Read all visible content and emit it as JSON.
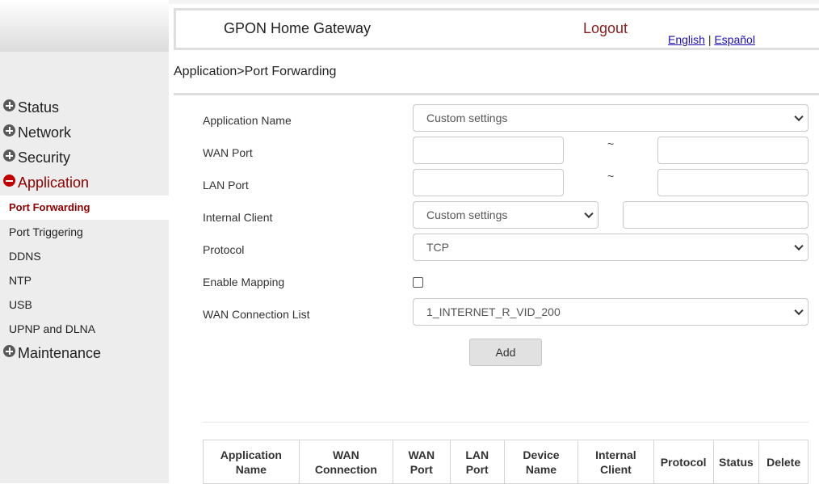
{
  "header": {
    "title": "GPON Home Gateway",
    "logout": "Logout",
    "lang_en": "English",
    "lang_sep": "|",
    "lang_es": "Español"
  },
  "breadcrumb": "Application>Port Forwarding",
  "menu": {
    "status": "Status",
    "network": "Network",
    "security": "Security",
    "application": "Application",
    "app_sub": [
      "Port Forwarding",
      "Port Triggering",
      "DDNS",
      "NTP",
      "USB",
      "UPNP and DLNA"
    ],
    "maintenance": "Maintenance"
  },
  "form": {
    "app_name_label": "Application Name",
    "app_name_value": "Custom settings",
    "wan_port_label": "WAN Port",
    "lan_port_label": "LAN Port",
    "range_sep": "~",
    "internal_client_label": "Internal Client",
    "internal_client_value": "Custom settings",
    "protocol_label": "Protocol",
    "protocol_value": "TCP",
    "enable_mapping_label": "Enable Mapping",
    "enable_mapping_checked": false,
    "wan_conn_label": "WAN Connection List",
    "wan_conn_value": "1_INTERNET_R_VID_200",
    "add_button": "Add"
  },
  "table": {
    "headers": [
      [
        "Application",
        "Name"
      ],
      [
        "WAN",
        "Connection"
      ],
      [
        "WAN",
        "Port"
      ],
      [
        "LAN",
        "Port"
      ],
      [
        "Device",
        "Name"
      ],
      [
        "Internal",
        "Client"
      ],
      [
        "Protocol"
      ],
      [
        "Status"
      ],
      [
        "Delete"
      ]
    ]
  },
  "colors": {
    "active_menu": "#8b0000",
    "logout": "#8b1a1a",
    "link": "#1a0dab",
    "minus_icon": "#c00000",
    "plus_icon": "#5a5a5a"
  }
}
